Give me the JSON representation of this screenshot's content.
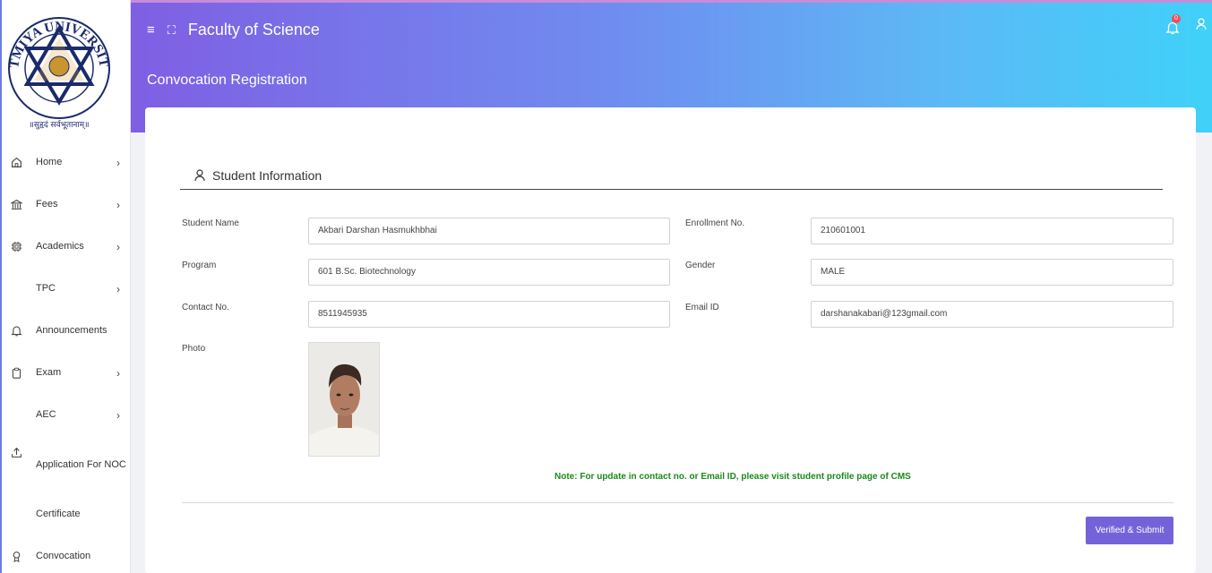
{
  "logo": {
    "text_top": "ATMIYA UNIVERSITY",
    "motto": "॥सुहृदं सर्वभूतानाम्॥"
  },
  "sidebar": {
    "items": [
      {
        "label": "Home",
        "icon": "home-icon",
        "has_arrow": true
      },
      {
        "label": "Fees",
        "icon": "bank-icon",
        "has_arrow": true
      },
      {
        "label": "Academics",
        "icon": "cpu-icon",
        "has_arrow": true
      },
      {
        "label": "TPC",
        "icon": "",
        "has_arrow": true
      },
      {
        "label": "Announcements",
        "icon": "bell-icon",
        "has_arrow": false
      },
      {
        "label": "Exam",
        "icon": "clipboard-icon",
        "has_arrow": true
      },
      {
        "label": "AEC",
        "icon": "",
        "has_arrow": true
      },
      {
        "label": "Application For NOC",
        "icon": "upload-icon",
        "has_arrow": false
      },
      {
        "label": "Certificate",
        "icon": "",
        "has_arrow": false
      },
      {
        "label": "Convocation",
        "icon": "award-icon",
        "has_arrow": false
      }
    ],
    "arrow": "›"
  },
  "header": {
    "faculty": "Faculty of Science",
    "page_title": "Convocation Registration",
    "notification_count": "0"
  },
  "section": {
    "title": "Student Information"
  },
  "form": {
    "student_name_label": "Student Name",
    "student_name": "Akbari Darshan Hasmukhbhai",
    "enrollment_label": "Enrollment No.",
    "enrollment": "210601001",
    "program_label": "Program",
    "program": "601 B.Sc. Biotechnology",
    "gender_label": "Gender",
    "gender": "MALE",
    "contact_label": "Contact No.",
    "contact": "8511945935",
    "email_label": "Email ID",
    "email": "darshanakabari@123gmail.com",
    "photo_label": "Photo"
  },
  "note": "Note: For update in contact no. or Email ID, please visit student profile page of CMS",
  "submit_label": "Verified & Submit",
  "colors": {
    "accent": "#7463d8",
    "note": "#1a8a1a",
    "header_start": "#7f5fe3",
    "header_end": "#3fd1f8"
  }
}
